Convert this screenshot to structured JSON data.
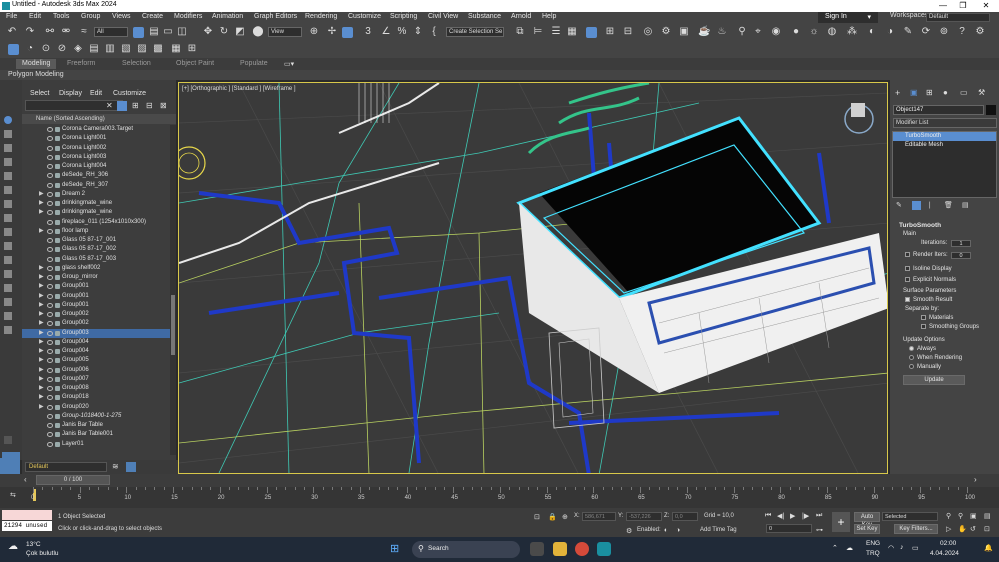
{
  "window": {
    "title": "Untitled - Autodesk 3ds Max 2024",
    "min": "—",
    "max": "❐",
    "close": "✕"
  },
  "menu": [
    "File",
    "Edit",
    "Tools",
    "Group",
    "Views",
    "Create",
    "Modifiers",
    "Animation",
    "Graph Editors",
    "Rendering",
    "Customize",
    "Scripting",
    "Civil View",
    "Substance",
    "Arnold",
    "Help"
  ],
  "account": {
    "sign_in": "Sign In",
    "workspaces_label": "Workspaces:",
    "workspace": "Default"
  },
  "toolbar": {
    "selection_filter": "All",
    "view_ref": "View",
    "named_selection": "Create Selection Se"
  },
  "ribbon": {
    "tabs": [
      "Modeling",
      "Freeform",
      "Selection",
      "Object Paint",
      "Populate"
    ],
    "active": "Modeling",
    "sub": "Polygon Modeling"
  },
  "scene_explorer": {
    "menus": [
      "Select",
      "Display",
      "Edit",
      "Customize"
    ],
    "column_header": "Name (Sorted Ascending)",
    "rows": [
      {
        "name": "Corona Camera003.Target",
        "exp": false,
        "sel": false,
        "it": false
      },
      {
        "name": "Corona Light001",
        "exp": false,
        "sel": false,
        "it": false
      },
      {
        "name": "Corona Light002",
        "exp": false,
        "sel": false,
        "it": false
      },
      {
        "name": "Corona Light003",
        "exp": false,
        "sel": false,
        "it": false
      },
      {
        "name": "Corona Light004",
        "exp": false,
        "sel": false,
        "it": false
      },
      {
        "name": "deSede_RH_306",
        "exp": false,
        "sel": false,
        "it": false
      },
      {
        "name": "deSede_RH_307",
        "exp": false,
        "sel": false,
        "it": false
      },
      {
        "name": "Dream 2",
        "exp": true,
        "sel": false,
        "it": false
      },
      {
        "name": "drinkingmate_wine",
        "exp": true,
        "sel": false,
        "it": false
      },
      {
        "name": "drinkingmate_wine",
        "exp": true,
        "sel": false,
        "it": false
      },
      {
        "name": "fireplace_011 (1254x1010x300)",
        "exp": false,
        "sel": false,
        "it": false
      },
      {
        "name": "floor lamp",
        "exp": true,
        "sel": false,
        "it": false
      },
      {
        "name": "Glass 05 87-17_001",
        "exp": false,
        "sel": false,
        "it": false
      },
      {
        "name": "Glass 05 87-17_002",
        "exp": false,
        "sel": false,
        "it": false
      },
      {
        "name": "Glass 05 87-17_003",
        "exp": false,
        "sel": false,
        "it": false
      },
      {
        "name": "glass shelf002",
        "exp": true,
        "sel": false,
        "it": false
      },
      {
        "name": "Group_mirror",
        "exp": true,
        "sel": false,
        "it": false
      },
      {
        "name": "Group001",
        "exp": true,
        "sel": false,
        "it": false
      },
      {
        "name": "Group001",
        "exp": true,
        "sel": false,
        "it": false
      },
      {
        "name": "Group001",
        "exp": true,
        "sel": false,
        "it": false
      },
      {
        "name": "Group002",
        "exp": true,
        "sel": false,
        "it": false
      },
      {
        "name": "Group002",
        "exp": true,
        "sel": false,
        "it": false
      },
      {
        "name": "Group003",
        "exp": true,
        "sel": true,
        "it": false
      },
      {
        "name": "Group004",
        "exp": true,
        "sel": false,
        "it": false
      },
      {
        "name": "Group004",
        "exp": true,
        "sel": false,
        "it": false
      },
      {
        "name": "Group005",
        "exp": true,
        "sel": false,
        "it": false
      },
      {
        "name": "Group006",
        "exp": true,
        "sel": false,
        "it": false
      },
      {
        "name": "Group007",
        "exp": true,
        "sel": false,
        "it": false
      },
      {
        "name": "Group008",
        "exp": true,
        "sel": false,
        "it": false
      },
      {
        "name": "Group018",
        "exp": true,
        "sel": false,
        "it": false
      },
      {
        "name": "Group020",
        "exp": true,
        "sel": false,
        "it": false
      },
      {
        "name": "Group-1018400-1-275",
        "exp": false,
        "sel": false,
        "it": true
      },
      {
        "name": "Janis Bar Table",
        "exp": false,
        "sel": false,
        "it": false
      },
      {
        "name": "Janis Bar Table001",
        "exp": false,
        "sel": false,
        "it": false
      },
      {
        "name": "Layer01",
        "exp": false,
        "sel": false,
        "it": false
      }
    ]
  },
  "viewport": {
    "label": "[+] [Orthographic ] [Standard ] [Wireframe ]"
  },
  "command_panel": {
    "object_name": "Object147",
    "modifier_list": "Modifier List",
    "stack": [
      "TurboSmooth",
      "Editable Mesh"
    ],
    "rollout": {
      "title": "TurboSmooth",
      "main": "Main",
      "iterations_label": "Iterations:",
      "iterations": "1",
      "render_iters_label": "Render Iters:",
      "render_iters": "0",
      "isoline": "Isoline Display",
      "explicit": "Explicit Normals",
      "surface": "Surface Parameters",
      "smooth_result": "Smooth Result",
      "separate_by": "Separate by:",
      "materials": "Materials",
      "smoothing_groups": "Smoothing Groups",
      "update_options": "Update Options",
      "always": "Always",
      "when_rendering": "When Rendering",
      "manually": "Manually",
      "update_btn": "Update"
    }
  },
  "layer": {
    "current": "Default"
  },
  "time": {
    "slider": "0 / 100",
    "ticks": [
      "0",
      "5",
      "10",
      "15",
      "20",
      "25",
      "30",
      "35",
      "40",
      "45",
      "50",
      "55",
      "60",
      "65",
      "70",
      "75",
      "80",
      "85",
      "90",
      "95",
      "100"
    ]
  },
  "status": {
    "maxscript": "21294 unused",
    "selected": "1 Object Selected",
    "prompt": "Click or click-and-drag to select objects",
    "x_label": "X:",
    "x": "586,671",
    "y_label": "Y:",
    "y": "-537,226",
    "z_label": "Z:",
    "z": "0,0",
    "grid": "Grid = 10,0",
    "enabled": "Enabled:",
    "add_time_tag": "Add Time Tag",
    "frame": "0",
    "auto_key": "Auto Key",
    "set_key": "Set Key",
    "selected_set": "Selected",
    "key_filters": "Key Filters..."
  },
  "taskbar": {
    "weather_temp": "13°C",
    "weather_desc": "Çok bulutlu",
    "search": "Search",
    "lang1": "ENG",
    "lang2": "TRQ",
    "time": "02:00",
    "date": "4.04.2024"
  }
}
